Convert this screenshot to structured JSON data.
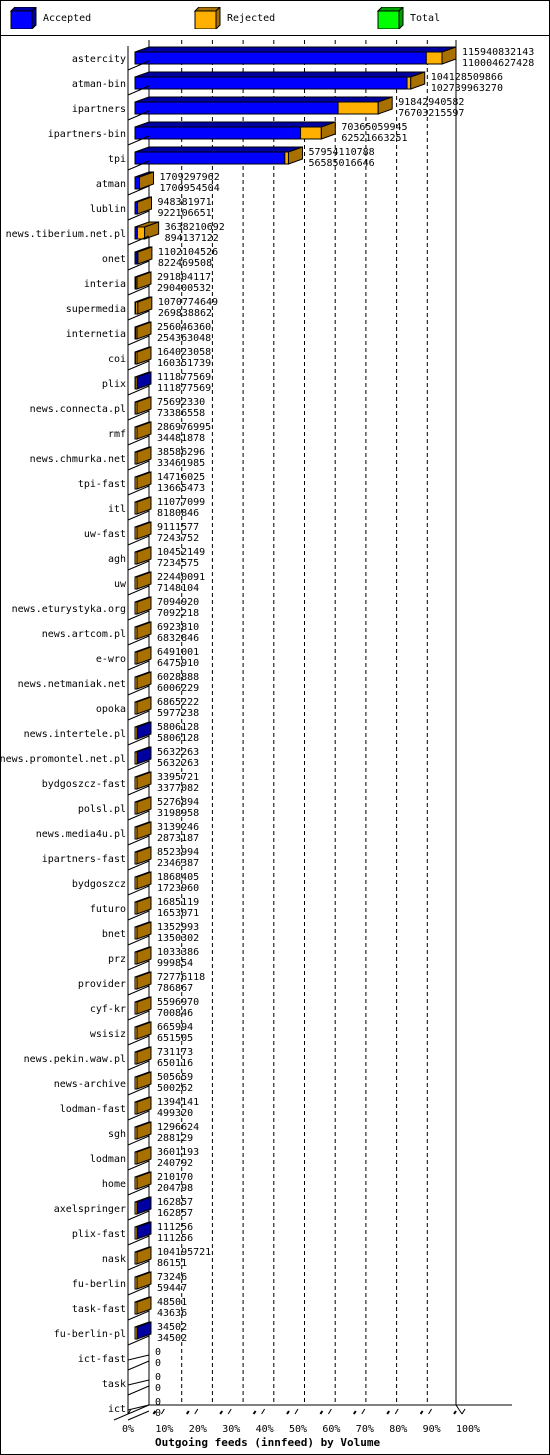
{
  "legend": [
    {
      "label": "Accepted",
      "color": "#0000ff",
      "side": "#0000a0"
    },
    {
      "label": "Rejected",
      "color": "#ffb000",
      "side": "#a87000"
    },
    {
      "label": "Total",
      "color": "#00ff00",
      "side": "#00a000"
    }
  ],
  "chart_data": {
    "type": "bar",
    "orientation": "horizontal",
    "stacked": true,
    "title": "Outgoing feeds (innfeed) by Volume",
    "xlabel": "Outgoing feeds (innfeed) by Volume",
    "ylabel": "",
    "x_ticks": [
      "0%",
      "10%",
      "20%",
      "30%",
      "40%",
      "50%",
      "60%",
      "70%",
      "80%",
      "90%",
      "100%"
    ],
    "xlim": [
      0,
      100
    ],
    "grid": true,
    "legend_position": "top",
    "colors": {
      "accepted": "#0000ff",
      "rejected": "#ffb000",
      "total": "#00ff00"
    },
    "categories": [
      "astercity",
      "atman-bin",
      "ipartners",
      "ipartners-bin",
      "tpi",
      "atman",
      "lublin",
      "news.tiberium.net.pl",
      "onet",
      "interia",
      "supermedia",
      "internetia",
      "coi",
      "plix",
      "news.connecta.pl",
      "rmf",
      "news.chmurka.net",
      "tpi-fast",
      "itl",
      "uw-fast",
      "agh",
      "uw",
      "news.eturystyka.org",
      "news.artcom.pl",
      "e-wro",
      "news.netmaniak.net",
      "opoka",
      "news.intertele.pl",
      "news.promontel.net.pl",
      "bydgoszcz-fast",
      "polsl.pl",
      "news.media4u.pl",
      "ipartners-fast",
      "bydgoszcz",
      "futuro",
      "bnet",
      "prz",
      "provider",
      "cyf-kr",
      "wsisiz",
      "news.pekin.waw.pl",
      "news-archive",
      "lodman-fast",
      "sgh",
      "lodman",
      "home",
      "axelspringer",
      "plix-fast",
      "nask",
      "fu-berlin",
      "task-fast",
      "fu-berlin-pl",
      "ict-fast",
      "task",
      "ict"
    ],
    "series": [
      {
        "name": "Total",
        "values": [
          115940832143,
          104128509866,
          91842940582,
          70365059945,
          57954110788,
          1709297962,
          948381971,
          3638210692,
          1102104526,
          291804117,
          1070774649,
          256046360,
          164023058,
          111877569,
          75692330,
          286976995,
          38586296,
          14716025,
          11077099,
          9111577,
          10452149,
          22440091,
          7094920,
          6923810,
          6491001,
          6028888,
          6865222,
          5806128,
          5632263,
          3395721,
          5276894,
          3139246,
          8523994,
          1868405,
          1685119,
          1352993,
          1033386,
          72776118,
          5596970,
          665994,
          731173,
          505659,
          1394141,
          1296624,
          3601193,
          210170,
          162857,
          111256,
          104195721,
          73246,
          48501,
          34502,
          0,
          0,
          0
        ]
      },
      {
        "name": "Accepted",
        "values": [
          110004627428,
          102739963270,
          76703215597,
          62521663251,
          56585016646,
          1700954504,
          922106651,
          894137122,
          822469508,
          290400532,
          269838862,
          254363048,
          160351739,
          111877569,
          73386558,
          34481878,
          33461985,
          13665473,
          8180846,
          7243752,
          7234575,
          7148104,
          7092218,
          6832846,
          6475910,
          6006229,
          5977238,
          5806128,
          5632263,
          3377082,
          3198958,
          2873187,
          2346387,
          1723960,
          1653071,
          1350302,
          999854,
          786867,
          700846,
          651505,
          650116,
          500262,
          499320,
          288129,
          240792,
          204798,
          162857,
          111256,
          86151,
          59447,
          43636,
          34502,
          0,
          0,
          0
        ]
      }
    ]
  }
}
